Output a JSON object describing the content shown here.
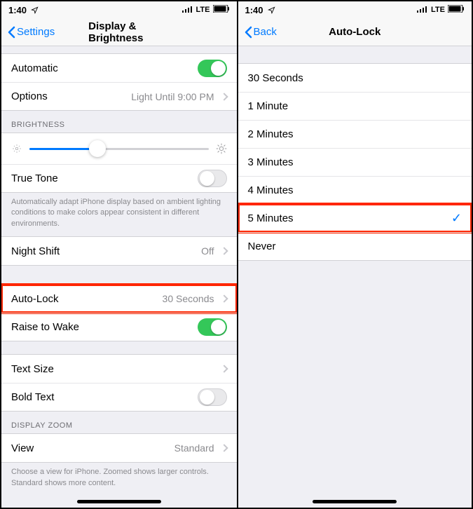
{
  "left": {
    "statusbar": {
      "time": "1:40",
      "network": "LTE"
    },
    "nav": {
      "back": "Settings",
      "title": "Display & Brightness"
    },
    "automatic": {
      "label": "Automatic",
      "on": true
    },
    "options": {
      "label": "Options",
      "detail": "Light Until 9:00 PM"
    },
    "brightness_header": "BRIGHTNESS",
    "brightness_value": 38,
    "truetone": {
      "label": "True Tone",
      "on": false
    },
    "truetone_footer": "Automatically adapt iPhone display based on ambient lighting conditions to make colors appear consistent in different environments.",
    "nightshift": {
      "label": "Night Shift",
      "detail": "Off"
    },
    "autolock": {
      "label": "Auto-Lock",
      "detail": "30 Seconds"
    },
    "raise": {
      "label": "Raise to Wake",
      "on": true
    },
    "textsize": {
      "label": "Text Size"
    },
    "boldtext": {
      "label": "Bold Text",
      "on": false
    },
    "zoom_header": "DISPLAY ZOOM",
    "view": {
      "label": "View",
      "detail": "Standard"
    },
    "zoom_footer": "Choose a view for iPhone. Zoomed shows larger controls. Standard shows more content."
  },
  "right": {
    "statusbar": {
      "time": "1:40",
      "network": "LTE"
    },
    "nav": {
      "back": "Back",
      "title": "Auto-Lock"
    },
    "options": [
      {
        "label": "30 Seconds",
        "selected": false
      },
      {
        "label": "1 Minute",
        "selected": false
      },
      {
        "label": "2 Minutes",
        "selected": false
      },
      {
        "label": "3 Minutes",
        "selected": false
      },
      {
        "label": "4 Minutes",
        "selected": false
      },
      {
        "label": "5 Minutes",
        "selected": true
      },
      {
        "label": "Never",
        "selected": false
      }
    ]
  }
}
